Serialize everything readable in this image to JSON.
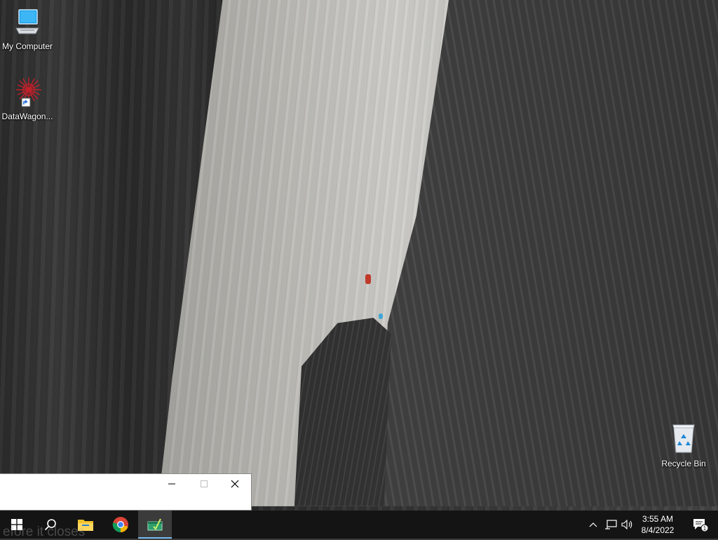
{
  "desktop": {
    "icons": [
      {
        "label": "My Computer",
        "icon": "computer-icon"
      },
      {
        "label": "DataWagon...",
        "icon": "datawagon-shortcut-icon"
      },
      {
        "label": "Recycle Bin",
        "icon": "recycle-bin-icon"
      }
    ]
  },
  "window": {
    "peek_text": "efore it closes"
  },
  "taskbar": {
    "items": [
      {
        "name": "start",
        "icon": "windows-start-icon"
      },
      {
        "name": "search",
        "icon": "search-icon"
      },
      {
        "name": "file-explorer",
        "icon": "folder-icon"
      },
      {
        "name": "chrome",
        "icon": "chrome-icon"
      },
      {
        "name": "active-app",
        "icon": "app-window-icon"
      }
    ],
    "tray": {
      "time": "3:55 AM",
      "date": "8/4/2022",
      "notification_count": "1"
    }
  },
  "colors": {
    "taskbar": "#141414",
    "active_indicator": "#76b9ed",
    "window_bg": "#ffffff"
  }
}
